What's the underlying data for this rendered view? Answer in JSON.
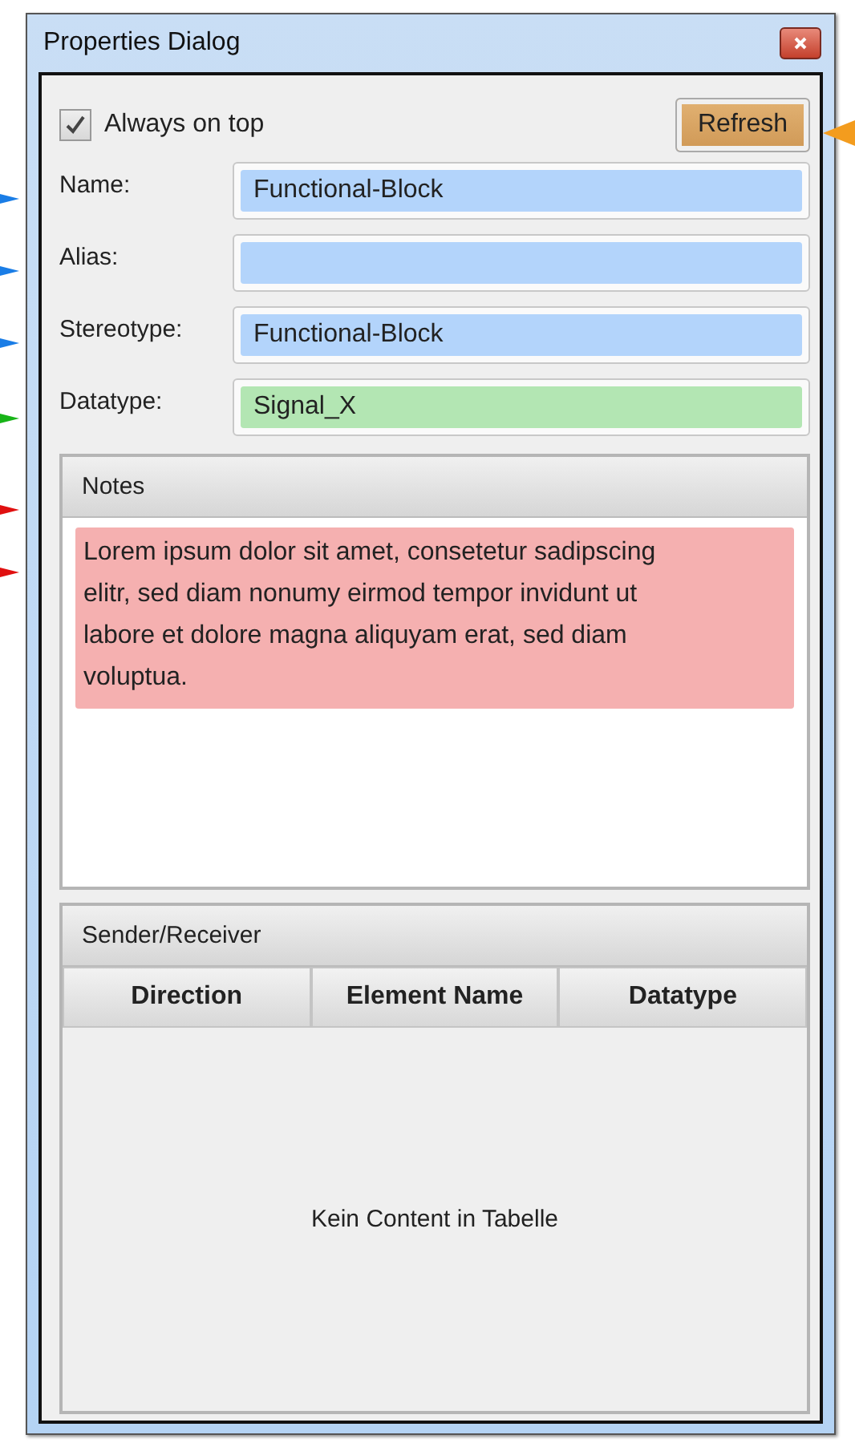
{
  "window": {
    "title": "Properties Dialog"
  },
  "always_on_top": {
    "label": "Always on top",
    "checked": true
  },
  "refresh_button": {
    "label": "Refresh"
  },
  "fields": [
    {
      "label": "Name:",
      "value": "Functional-Block",
      "color": "#b3d4fb"
    },
    {
      "label": "Alias:",
      "color": "#b3d4fb"
    },
    {
      "label": "Stereotype:",
      "value": "Functional-Block",
      "color": "#b3d4fb"
    },
    {
      "label": "Datatype:",
      "value": "Signal_X",
      "color": "#b3e6b3"
    }
  ],
  "notes": {
    "title": "Notes",
    "text": "Lorem ipsum dolor sit amet, consetetur sadipscing elitr, sed diam nonumy eirmod tempor invidunt ut labore et dolore magna aliquyam erat, sed diam voluptua.",
    "color": "#f5b0b0"
  },
  "sender_receiver": {
    "title": "Sender/Receiver",
    "columns": [
      "Direction",
      "Element Name",
      "Datatype"
    ],
    "empty_message": "Kein Content in Tabelle"
  },
  "markers": [
    {
      "kind": "right",
      "color": "#f39c1e"
    },
    {
      "kind": "left",
      "color": "#1a7de6"
    },
    {
      "kind": "left",
      "color": "#1a7de6"
    },
    {
      "kind": "left",
      "color": "#1a7de6"
    },
    {
      "kind": "left",
      "color": "#18b418"
    },
    {
      "kind": "left",
      "color": "#e01010"
    },
    {
      "kind": "left",
      "color": "#e01010"
    }
  ]
}
